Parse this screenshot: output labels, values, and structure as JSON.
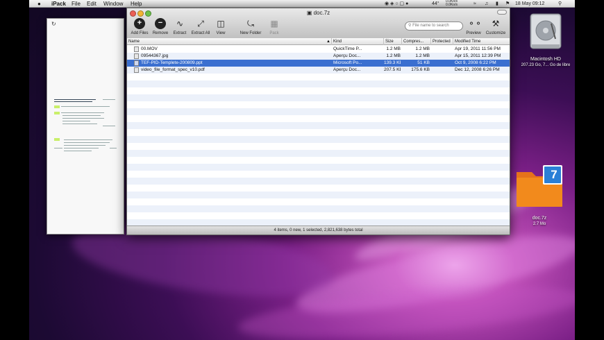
{
  "menubar": {
    "apple": "",
    "app": "iPack",
    "items": [
      "File",
      "Edit",
      "Window",
      "Help"
    ],
    "tray": {
      "temp": "44°",
      "net_up": "0.0Ko/s",
      "net_down": "0.0Ko/s",
      "datetime": "18 May 09:12"
    }
  },
  "window": {
    "title": "doc.7z",
    "toolbar": [
      {
        "label": "Add Files",
        "icon": "add-icon"
      },
      {
        "label": "Remove",
        "icon": "remove-icon"
      },
      {
        "label": "Extract",
        "icon": "extract-icon"
      },
      {
        "label": "Extract All",
        "icon": "extract-all-icon"
      },
      {
        "label": "View",
        "icon": "view-icon"
      },
      {
        "label": "New Folder",
        "icon": "new-folder-icon"
      },
      {
        "label": "Pack",
        "icon": "pack-icon",
        "disabled": true
      },
      {
        "label": "Preview",
        "icon": "glasses-icon"
      },
      {
        "label": "Customize",
        "icon": "tools-icon"
      }
    ],
    "search": {
      "placeholder": "File name to search"
    },
    "columns": [
      "Name",
      "Kind",
      "Size",
      "Compres...",
      "Protected",
      "Modified Time"
    ],
    "files": [
      {
        "name": "00.MOV",
        "kind": "QuickTime P...",
        "size": "1.2 MB",
        "compressed": "1.2 MB",
        "protected": "",
        "modified": "Apr 19, 2011 11:56 PM",
        "selected": false
      },
      {
        "name": "09544367.jpg",
        "kind": "Aperçu Doc...",
        "size": "1.2 MB",
        "compressed": "1.2 MB",
        "protected": "",
        "modified": "Apr 15, 2011 12:39 PM",
        "selected": false
      },
      {
        "name": "TEF-PID-Templete-200809.ppt",
        "kind": "Microsoft Po...",
        "size": "139.3 KB",
        "compressed": "51 KB",
        "protected": "",
        "modified": "Oct 9, 2008 6:22 PM",
        "selected": true
      },
      {
        "name": "video_file_format_spec_v10.pdf",
        "kind": "Aperçu Doc...",
        "size": "207.5 KB",
        "compressed": "175.6 KB",
        "protected": "",
        "modified": "Dec 12, 2008 6:26 PM",
        "selected": false
      }
    ],
    "status": "4 items, 0 new, 1 selected, 2,821,638 bytes total"
  },
  "desktop": {
    "hd": {
      "name": "Macintosh HD",
      "info": "207.23 Go, 7... Go de libre"
    },
    "archive": {
      "name": "doc.7z",
      "info": "2.7 Mo",
      "badge": "7"
    }
  },
  "colors": {
    "selection": "#3a6fd0",
    "stripe": "#ecf1fa",
    "archive_orange": "#f28a1c",
    "badge_blue": "#2a7fd6"
  }
}
